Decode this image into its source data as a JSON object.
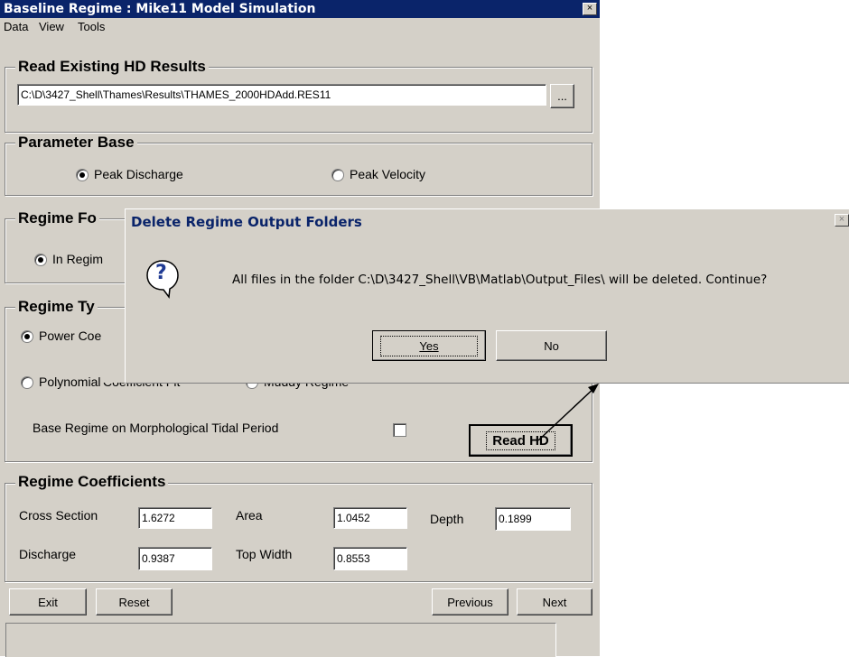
{
  "window": {
    "title": "Baseline Regime  :  Mike11 Model Simulation",
    "close_glyph": "×"
  },
  "menu": {
    "items": [
      "Data",
      "View",
      "Tools"
    ]
  },
  "read_hd": {
    "legend": "Read Existing HD Results",
    "path": "C:\\D\\3427_Shell\\Thames\\Results\\THAMES_2000HDAdd.RES11",
    "browse_label": "..."
  },
  "parameter_base": {
    "legend": "Parameter Base",
    "options": [
      "Peak Discharge",
      "Peak Velocity"
    ],
    "selected": "Peak Discharge"
  },
  "regime_folder": {
    "legend": "Regime Fo",
    "option": "In Regim"
  },
  "regime_type": {
    "legend": "Regime Ty",
    "option_power": "Power Coe",
    "option_polynomial": "Polynomial",
    "option_polynomial_hidden": "Coefficient Fit",
    "option_muddy": "Muddy Regime",
    "base_on_tidal_label": "Base Regime on Morphological Tidal Period",
    "read_hd_button": "Read HD"
  },
  "coefficients": {
    "legend": "Regime Coefficients",
    "cross_section": {
      "label": "Cross Section",
      "value": "1.6272"
    },
    "area": {
      "label": "Area",
      "value": "1.0452"
    },
    "depth": {
      "label": "Depth",
      "value": "0.1899"
    },
    "discharge": {
      "label": "Discharge",
      "value": "0.9387"
    },
    "top_width": {
      "label": "Top Width",
      "value": "0.8553"
    }
  },
  "buttons": {
    "exit": "Exit",
    "reset": "Reset",
    "previous": "Previous",
    "next": "Next"
  },
  "dialog": {
    "title": "Delete Regime Output Folders",
    "message": "All files in the folder C:\\D\\3427_Shell\\VB\\Matlab\\Output_Files\\ will be deleted. Continue?",
    "yes": "Yes",
    "no": "No",
    "question_glyph": "?",
    "close_glyph": "×"
  },
  "colors": {
    "titlebar": "#0a246a",
    "face": "#d4d0c8",
    "dialog_title": "#0a246a"
  }
}
